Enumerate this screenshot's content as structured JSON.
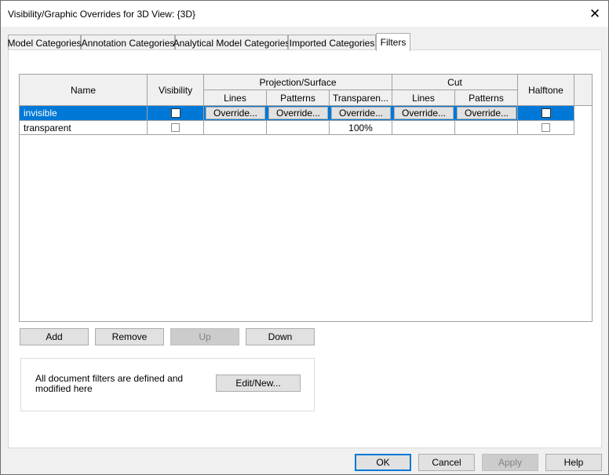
{
  "window": {
    "title": "Visibility/Graphic Overrides for 3D View: {3D}",
    "close_glyph": "✕"
  },
  "tabs": [
    {
      "label": "Model Categories"
    },
    {
      "label": "Annotation Categories"
    },
    {
      "label": "Analytical Model Categories"
    },
    {
      "label": "Imported Categories"
    },
    {
      "label": "Filters",
      "active": true
    }
  ],
  "table": {
    "headers": {
      "name": "Name",
      "visibility": "Visibility",
      "projection_surface": "Projection/Surface",
      "cut": "Cut",
      "halftone": "Halftone",
      "sub": {
        "lines": "Lines",
        "patterns": "Patterns",
        "transparency": "Transparen...",
        "cut_lines": "Lines",
        "cut_patterns": "Patterns"
      }
    },
    "rows": [
      {
        "name": "invisible",
        "selected": true,
        "visibility_checked": false,
        "lines": "Override...",
        "patterns": "Override...",
        "transparency": "Override...",
        "cut_lines": "Override...",
        "cut_patterns": "Override...",
        "halftone_checked": false
      },
      {
        "name": "transparent",
        "selected": false,
        "visibility_checked": false,
        "lines": "",
        "patterns": "",
        "transparency": "100%",
        "cut_lines": "",
        "cut_patterns": "",
        "halftone_checked": false
      }
    ]
  },
  "row_buttons": {
    "add": "Add",
    "remove": "Remove",
    "up": "Up",
    "down": "Down"
  },
  "filters_group": {
    "text": "All document filters are defined and modified here",
    "edit_new": "Edit/New..."
  },
  "footer": {
    "ok": "OK",
    "cancel": "Cancel",
    "apply": "Apply",
    "help": "Help"
  },
  "colors": {
    "selection": "#0078d7",
    "dialog_bg": "#f0f0f0"
  }
}
